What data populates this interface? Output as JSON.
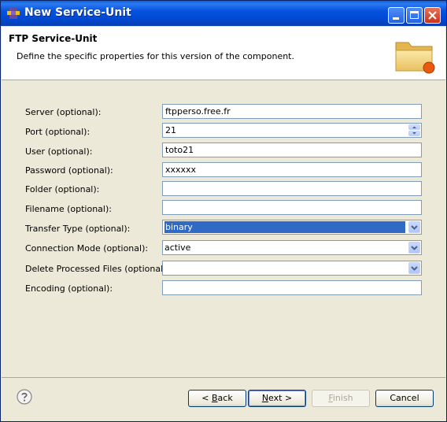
{
  "window": {
    "title": "New Service-Unit"
  },
  "header": {
    "title": "FTP Service-Unit",
    "description": "Define the specific properties for this version of the component."
  },
  "form": {
    "fields": [
      {
        "label": "Server (optional):",
        "value": "ftpperso.free.fr",
        "kind": "text"
      },
      {
        "label": "Port (optional):",
        "value": "21",
        "kind": "spinner"
      },
      {
        "label": "User (optional):",
        "value": "toto21",
        "kind": "text"
      },
      {
        "label": "Password (optional):",
        "value": "xxxxxx",
        "kind": "text"
      },
      {
        "label": "Folder (optional):",
        "value": "",
        "kind": "text"
      },
      {
        "label": "Filename (optional):",
        "value": "",
        "kind": "text"
      },
      {
        "label": "Transfer Type (optional):",
        "value": "binary",
        "kind": "select"
      },
      {
        "label": "Connection Mode (optional):",
        "value": "active",
        "kind": "select"
      },
      {
        "label": "Delete Processed Files (optional):",
        "value": "",
        "kind": "select"
      },
      {
        "label": "Encoding (optional):",
        "value": "",
        "kind": "text"
      }
    ]
  },
  "buttons": {
    "back": {
      "prefix": "< ",
      "mnemonic": "B",
      "rest": "ack"
    },
    "next": {
      "mnemonic": "N",
      "rest": "ext >"
    },
    "finish": {
      "mnemonic": "F",
      "rest": "inish"
    },
    "cancel": "Cancel"
  },
  "icons": {
    "help": "help-icon",
    "folder": "folder-icon"
  },
  "colors": {
    "titlebar": "#0553e0",
    "selection": "#316ac5",
    "dialog_bg": "#ece9d8"
  }
}
